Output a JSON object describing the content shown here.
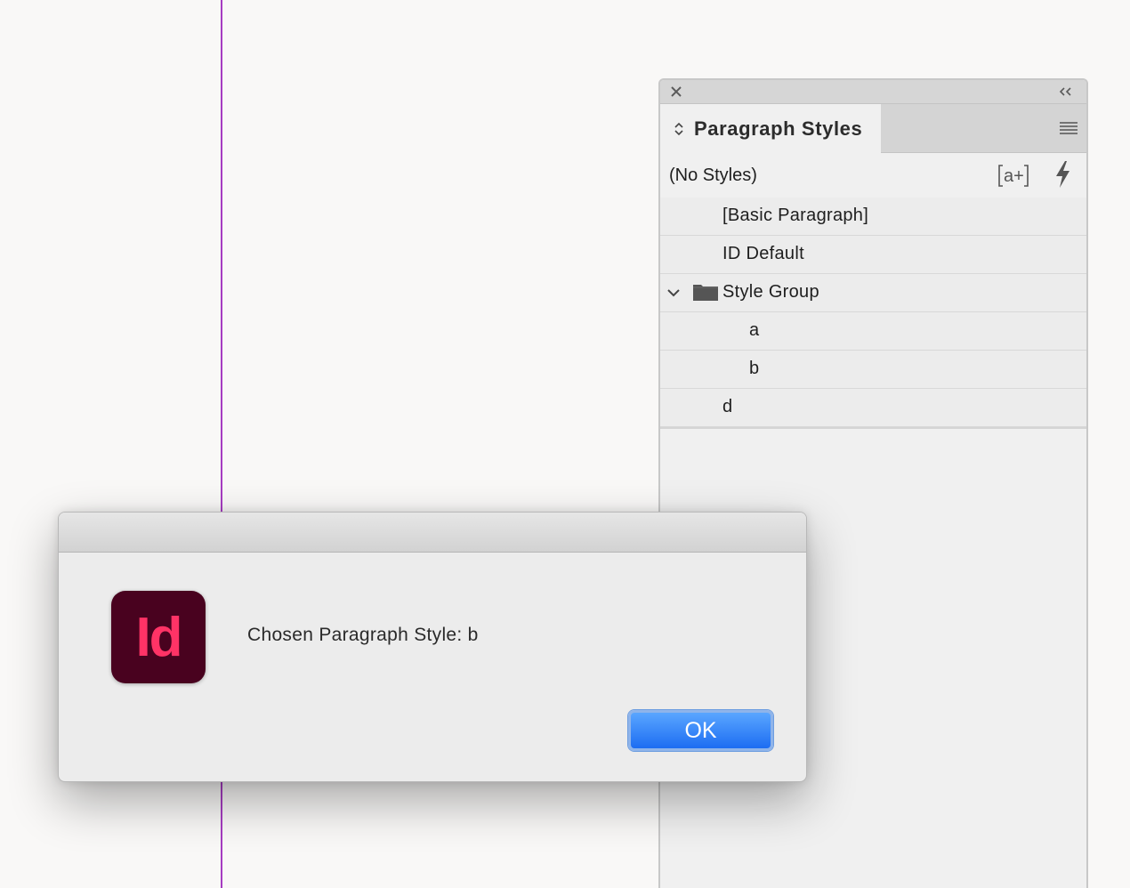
{
  "colors": {
    "guide": "#a63cc2",
    "panel_bg": "#f0f0f0",
    "app_icon_bg": "#49021f",
    "app_icon_text": "#ff3366",
    "ok_button": "#1d6df2"
  },
  "panel": {
    "close_icon": "close-icon",
    "collapse_icon": "double-chevron-left-icon",
    "tab_title": "Paragraph Styles",
    "menu_icon": "hamburger-menu-icon",
    "current_style": "(No Styles)",
    "toolbar_icons": [
      "quick-apply-icon",
      "lightning-icon"
    ],
    "styles": [
      {
        "label": "[Basic Paragraph]",
        "level": 0
      },
      {
        "label": "ID Default",
        "level": 0
      },
      {
        "label": "Style Group",
        "level": 0,
        "group": true,
        "expanded": true
      },
      {
        "label": "a",
        "level": 1
      },
      {
        "label": "b",
        "level": 1
      },
      {
        "label": "d",
        "level": 0
      }
    ]
  },
  "dialog": {
    "app_icon_text": "Id",
    "message": "Chosen Paragraph Style: b",
    "ok_label": "OK"
  }
}
